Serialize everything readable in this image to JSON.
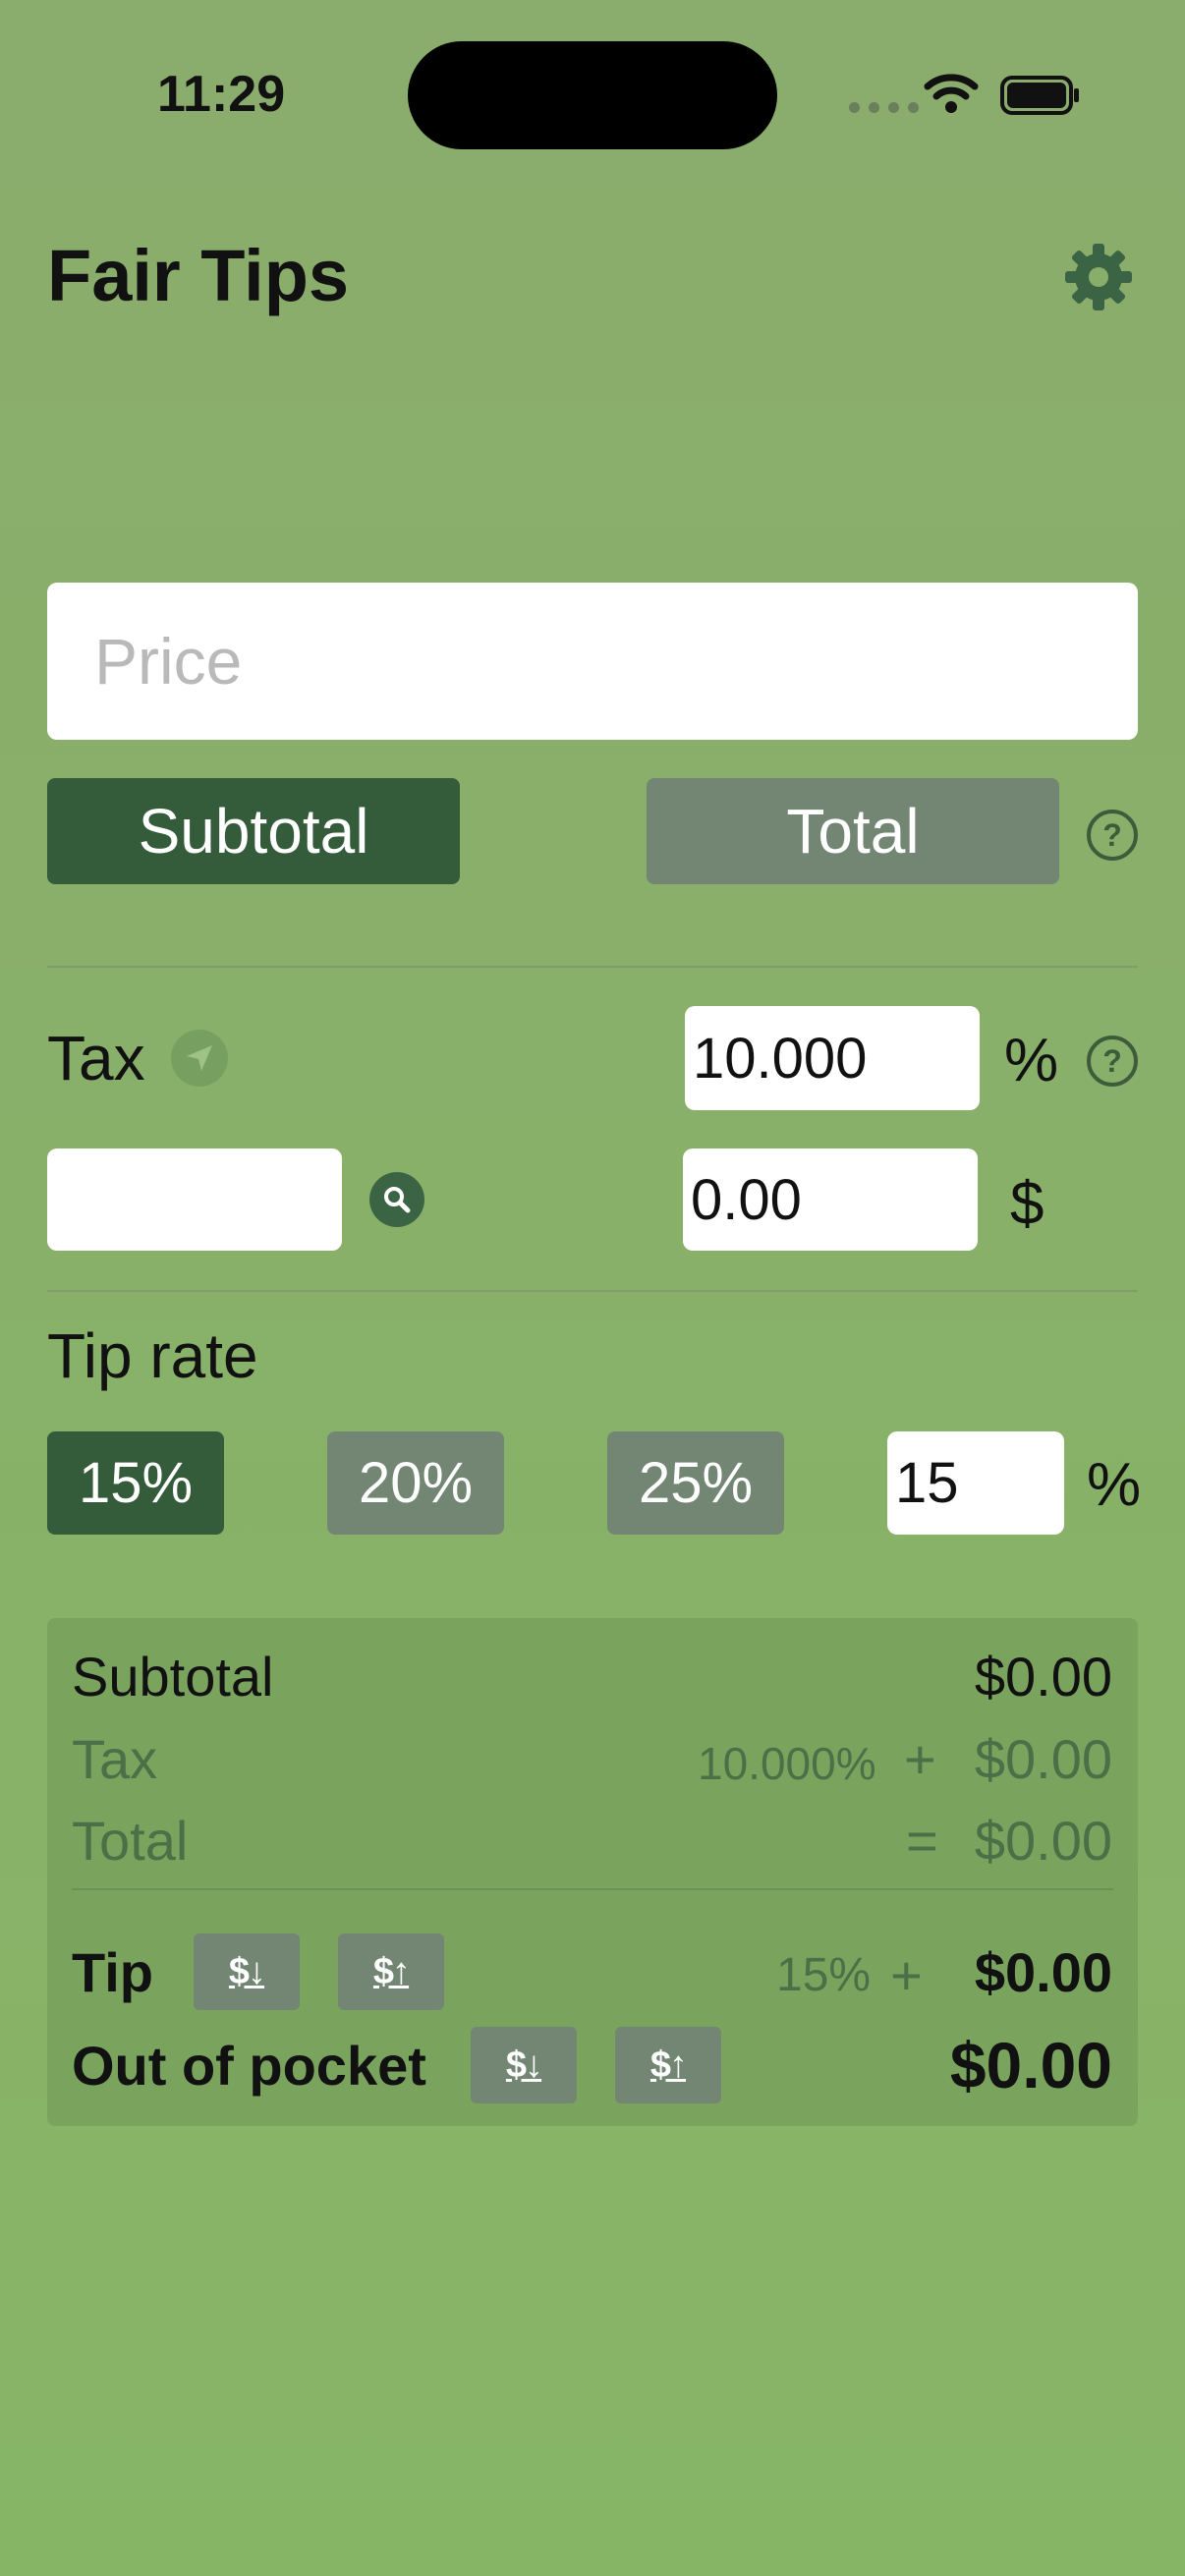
{
  "status_bar": {
    "time": "11:29"
  },
  "header": {
    "title": "Fair Tips",
    "settings_icon": "gear-icon"
  },
  "price": {
    "placeholder": "Price",
    "value": ""
  },
  "mode": {
    "subtotal_label": "Subtotal",
    "total_label": "Total",
    "selected": "Subtotal"
  },
  "tax": {
    "label": "Tax",
    "rate_value": "10.000",
    "rate_unit": "%",
    "location_value": "",
    "amount_value": "0.00",
    "amount_unit": "$"
  },
  "tip": {
    "label": "Tip rate",
    "presets": [
      "15%",
      "20%",
      "25%"
    ],
    "selected": "15%",
    "custom_value": "15",
    "custom_unit": "%"
  },
  "summary": {
    "subtotal_label": "Subtotal",
    "subtotal_value": "$0.00",
    "tax_label": "Tax",
    "tax_rate": "10.000%",
    "tax_plus": "+",
    "tax_value": "$0.00",
    "total_label": "Total",
    "total_eq": "=",
    "total_value": "$0.00",
    "tip_label": "Tip",
    "tip_rate": "15%",
    "tip_plus": "+",
    "tip_value": "$0.00",
    "oop_label": "Out of pocket",
    "oop_value": "$0.00",
    "round_down_icon": "$↓",
    "round_up_icon": "$↑"
  },
  "colors": {
    "background": "#87b566",
    "accent_dark": "#345c3a",
    "button_gray": "#728673",
    "summary_bg": "#7aa45e"
  }
}
